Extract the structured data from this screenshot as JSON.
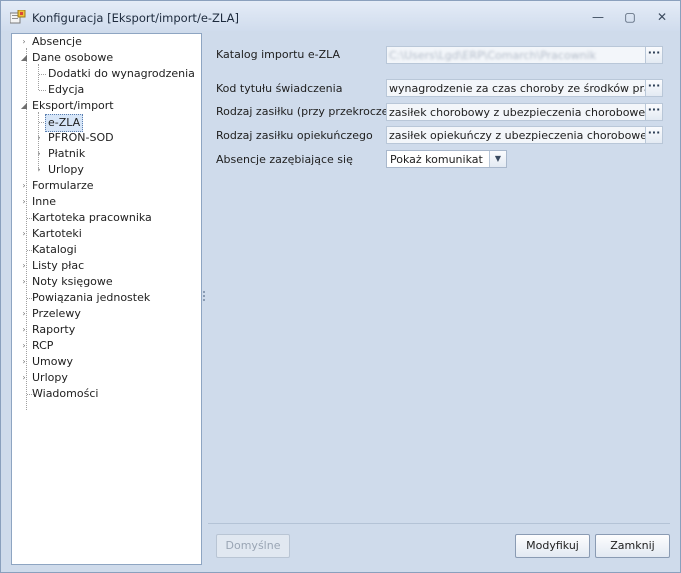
{
  "window": {
    "title": "Konfiguracja [Eksport/import/e-ZLA]",
    "icon": "config-app-icon",
    "controls": {
      "minimize": "—",
      "maximize": "▢",
      "close": "✕"
    }
  },
  "tree": [
    {
      "label": "Absencje",
      "expander": "›"
    },
    {
      "label": "Dane osobowe",
      "expander": "◢"
    },
    {
      "label": "Dodatki do wynagrodzenia",
      "expander": ""
    },
    {
      "label": "Edycja",
      "expander": ""
    },
    {
      "label": "Eksport/import",
      "expander": "◢"
    },
    {
      "label": "e-ZLA",
      "expander": ""
    },
    {
      "label": "PFRON-SOD",
      "expander": "›"
    },
    {
      "label": "Płatnik",
      "expander": "›"
    },
    {
      "label": "Urlopy",
      "expander": "›"
    },
    {
      "label": "Formularze",
      "expander": "›"
    },
    {
      "label": "Inne",
      "expander": "›"
    },
    {
      "label": "Kartoteka pracownika",
      "expander": ""
    },
    {
      "label": "Kartoteki",
      "expander": "›"
    },
    {
      "label": "Katalogi",
      "expander": ""
    },
    {
      "label": "Listy płac",
      "expander": "›"
    },
    {
      "label": "Noty księgowe",
      "expander": "›"
    },
    {
      "label": "Powiązania jednostek",
      "expander": ""
    },
    {
      "label": "Przelewy",
      "expander": "›"
    },
    {
      "label": "Raporty",
      "expander": "›"
    },
    {
      "label": "RCP",
      "expander": "›"
    },
    {
      "label": "Umowy",
      "expander": "›"
    },
    {
      "label": "Urlopy",
      "expander": "›"
    },
    {
      "label": "Wiadomości",
      "expander": ""
    }
  ],
  "form": {
    "catalog_label": "Katalog importu e-ZLA",
    "catalog_value": "C:\\Users\\Lgd\\ERP\\Comarch\\Pracownik",
    "benefit_title_label": "Kod tytułu świadczenia",
    "benefit_title_value": "wynagrodzenie za czas choroby ze środków pracodawcy",
    "sickness_type_label": "Rodzaj zasiłku (przy przekroczeniu)",
    "sickness_type_value": "zasiłek chorobowy z ubezpieczenia chorobowego",
    "care_type_label": "Rodzaj zasiłku opiekuńczego",
    "care_type_value": "zasiłek opiekuńczy z ubezpieczenia chorobowego",
    "overlap_label": "Absencje zazębiające się",
    "overlap_value": "Pokaż komunikat",
    "dots": "···",
    "dropdown_arrow": "▼"
  },
  "buttons": {
    "defaults": "Domyślne",
    "modify": "Modyfikuj",
    "close": "Zamknij"
  }
}
